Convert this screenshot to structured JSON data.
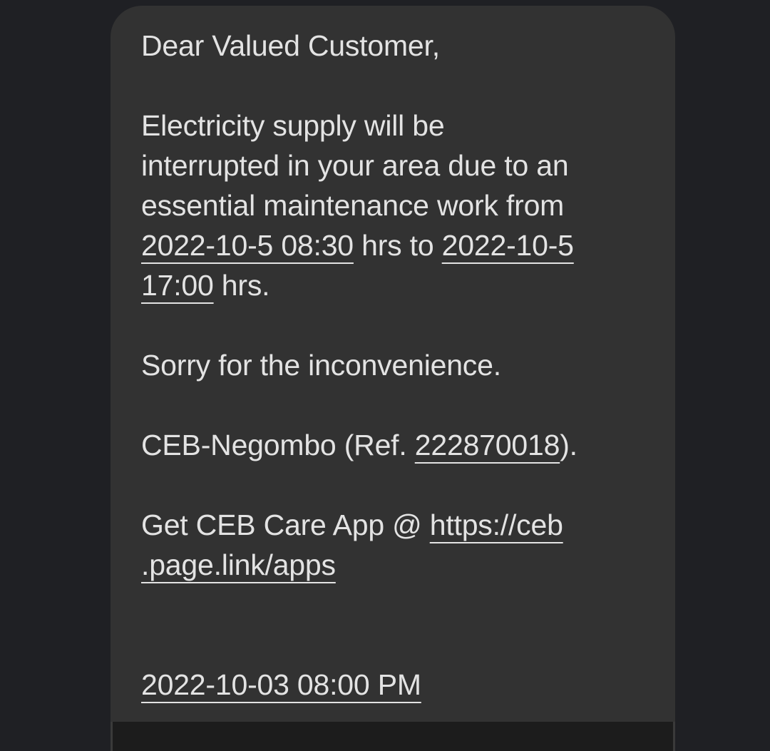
{
  "message": {
    "greeting": "Dear Valued Customer,",
    "body_line1": "Electricity supply will be",
    "body_line2": "interrupted in your area due to an",
    "body_line3": "essential maintenance work from",
    "start_datetime": "2022-10-5 08:30",
    "hrs_to": " hrs to ",
    "end_date": "2022-10-5",
    "end_time": "17:00",
    "hrs_end": " hrs.",
    "apology": "Sorry for the inconvenience.",
    "sender_prefix": "CEB-Negombo (Ref. ",
    "reference": "222870018",
    "sender_suffix": ").",
    "app_prefix": "Get CEB Care App @ ",
    "link_part1": "https://ceb",
    "link_part2": ".page.link/apps",
    "timestamp": "2022-10-03 08:00 PM"
  },
  "colors": {
    "background": "#1f2024",
    "bubble": "#323232",
    "text": "#e3e3e3"
  }
}
